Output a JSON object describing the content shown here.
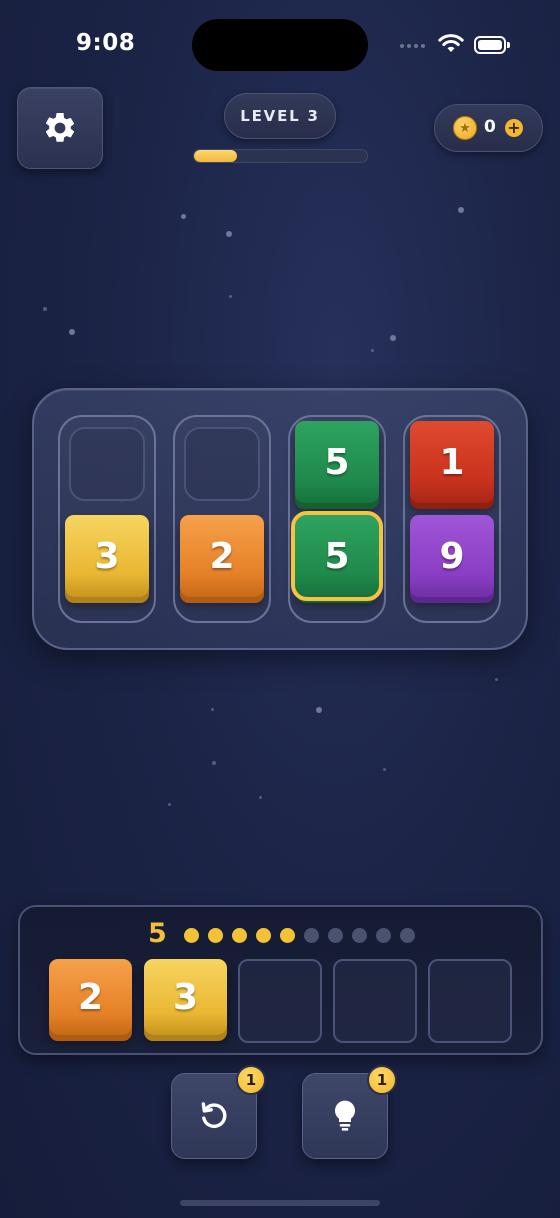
{
  "status_bar": {
    "time": "9:08"
  },
  "header": {
    "level_label": "LEVEL 3",
    "level_progress": 0.25,
    "coins": "0"
  },
  "board": {
    "columns": [
      {
        "tiles": [
          {
            "value": "3",
            "color": "yellow"
          }
        ]
      },
      {
        "tiles": [
          {
            "value": "2",
            "color": "orange"
          }
        ]
      },
      {
        "tiles": [
          {
            "value": "5",
            "color": "green"
          },
          {
            "value": "5",
            "color": "green",
            "selected": true
          }
        ]
      },
      {
        "tiles": [
          {
            "value": "1",
            "color": "red"
          },
          {
            "value": "9",
            "color": "purple"
          }
        ]
      }
    ]
  },
  "tray": {
    "count": "5",
    "dots_filled": 5,
    "dots_total": 10,
    "tiles": [
      {
        "value": "2",
        "color": "orange"
      },
      {
        "value": "3",
        "color": "yellow"
      }
    ],
    "slots_total": 5
  },
  "actions": {
    "undo": {
      "icon": "undo-icon",
      "badge": "1"
    },
    "hint": {
      "icon": "lightbulb-icon",
      "badge": "1"
    }
  },
  "colors": {
    "accent": "#f4c236",
    "background": "#1c2447"
  }
}
